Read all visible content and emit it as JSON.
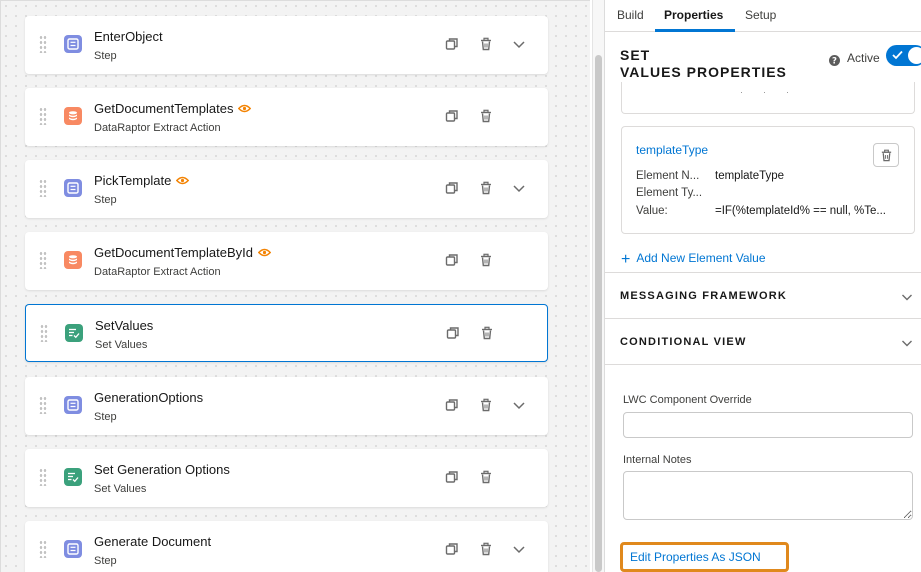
{
  "steps": [
    {
      "name": "EnterObject",
      "type": "Step",
      "icon": "step",
      "preview": false,
      "expandable": true
    },
    {
      "name": "GetDocumentTemplates",
      "type": "DataRaptor Extract Action",
      "icon": "dataraptor",
      "preview": true,
      "expandable": false
    },
    {
      "name": "PickTemplate",
      "type": "Step",
      "icon": "step",
      "preview": true,
      "expandable": true
    },
    {
      "name": "GetDocumentTemplateById",
      "type": "DataRaptor Extract Action",
      "icon": "dataraptor",
      "preview": true,
      "expandable": false
    },
    {
      "name": "SetValues",
      "type": "Set Values",
      "icon": "set-values",
      "preview": false,
      "expandable": false,
      "selected": true
    },
    {
      "name": "GenerationOptions",
      "type": "Step",
      "icon": "step",
      "preview": false,
      "expandable": true
    },
    {
      "name": "Set Generation Options",
      "type": "Set Values",
      "icon": "set-values",
      "preview": false,
      "expandable": false
    },
    {
      "name": "Generate Document",
      "type": "Step",
      "icon": "step",
      "preview": false,
      "expandable": true
    }
  ],
  "panel": {
    "tabs": [
      "Build",
      "Properties",
      "Setup"
    ],
    "active_tab": "Properties",
    "title_line1": "SET",
    "title_line2": "VALUES PROPERTIES",
    "active_label": "Active",
    "active_on": true,
    "element": {
      "name": "templateType",
      "rows": [
        {
          "key": "Element N...",
          "value": "templateType"
        },
        {
          "key": "Element Ty...",
          "value": ""
        },
        {
          "key": "Value:",
          "value": "=IF(%templateId% == null, %Te..."
        }
      ]
    },
    "add_element_label": "Add New Element Value",
    "sections": [
      "MESSAGING FRAMEWORK",
      "CONDITIONAL VIEW"
    ],
    "lwc_override_label": "LWC Component Override",
    "lwc_override_value": "",
    "internal_notes_label": "Internal Notes",
    "internal_notes_value": "",
    "edit_json_label": "Edit Properties As JSON"
  },
  "colors": {
    "accent": "#0176d3",
    "step_icon": "#7f8de1",
    "dataraptor_icon": "#f88962",
    "set_values_icon": "#3ba17c",
    "preview_eye": "#f38303",
    "highlight": "#e0891d"
  }
}
